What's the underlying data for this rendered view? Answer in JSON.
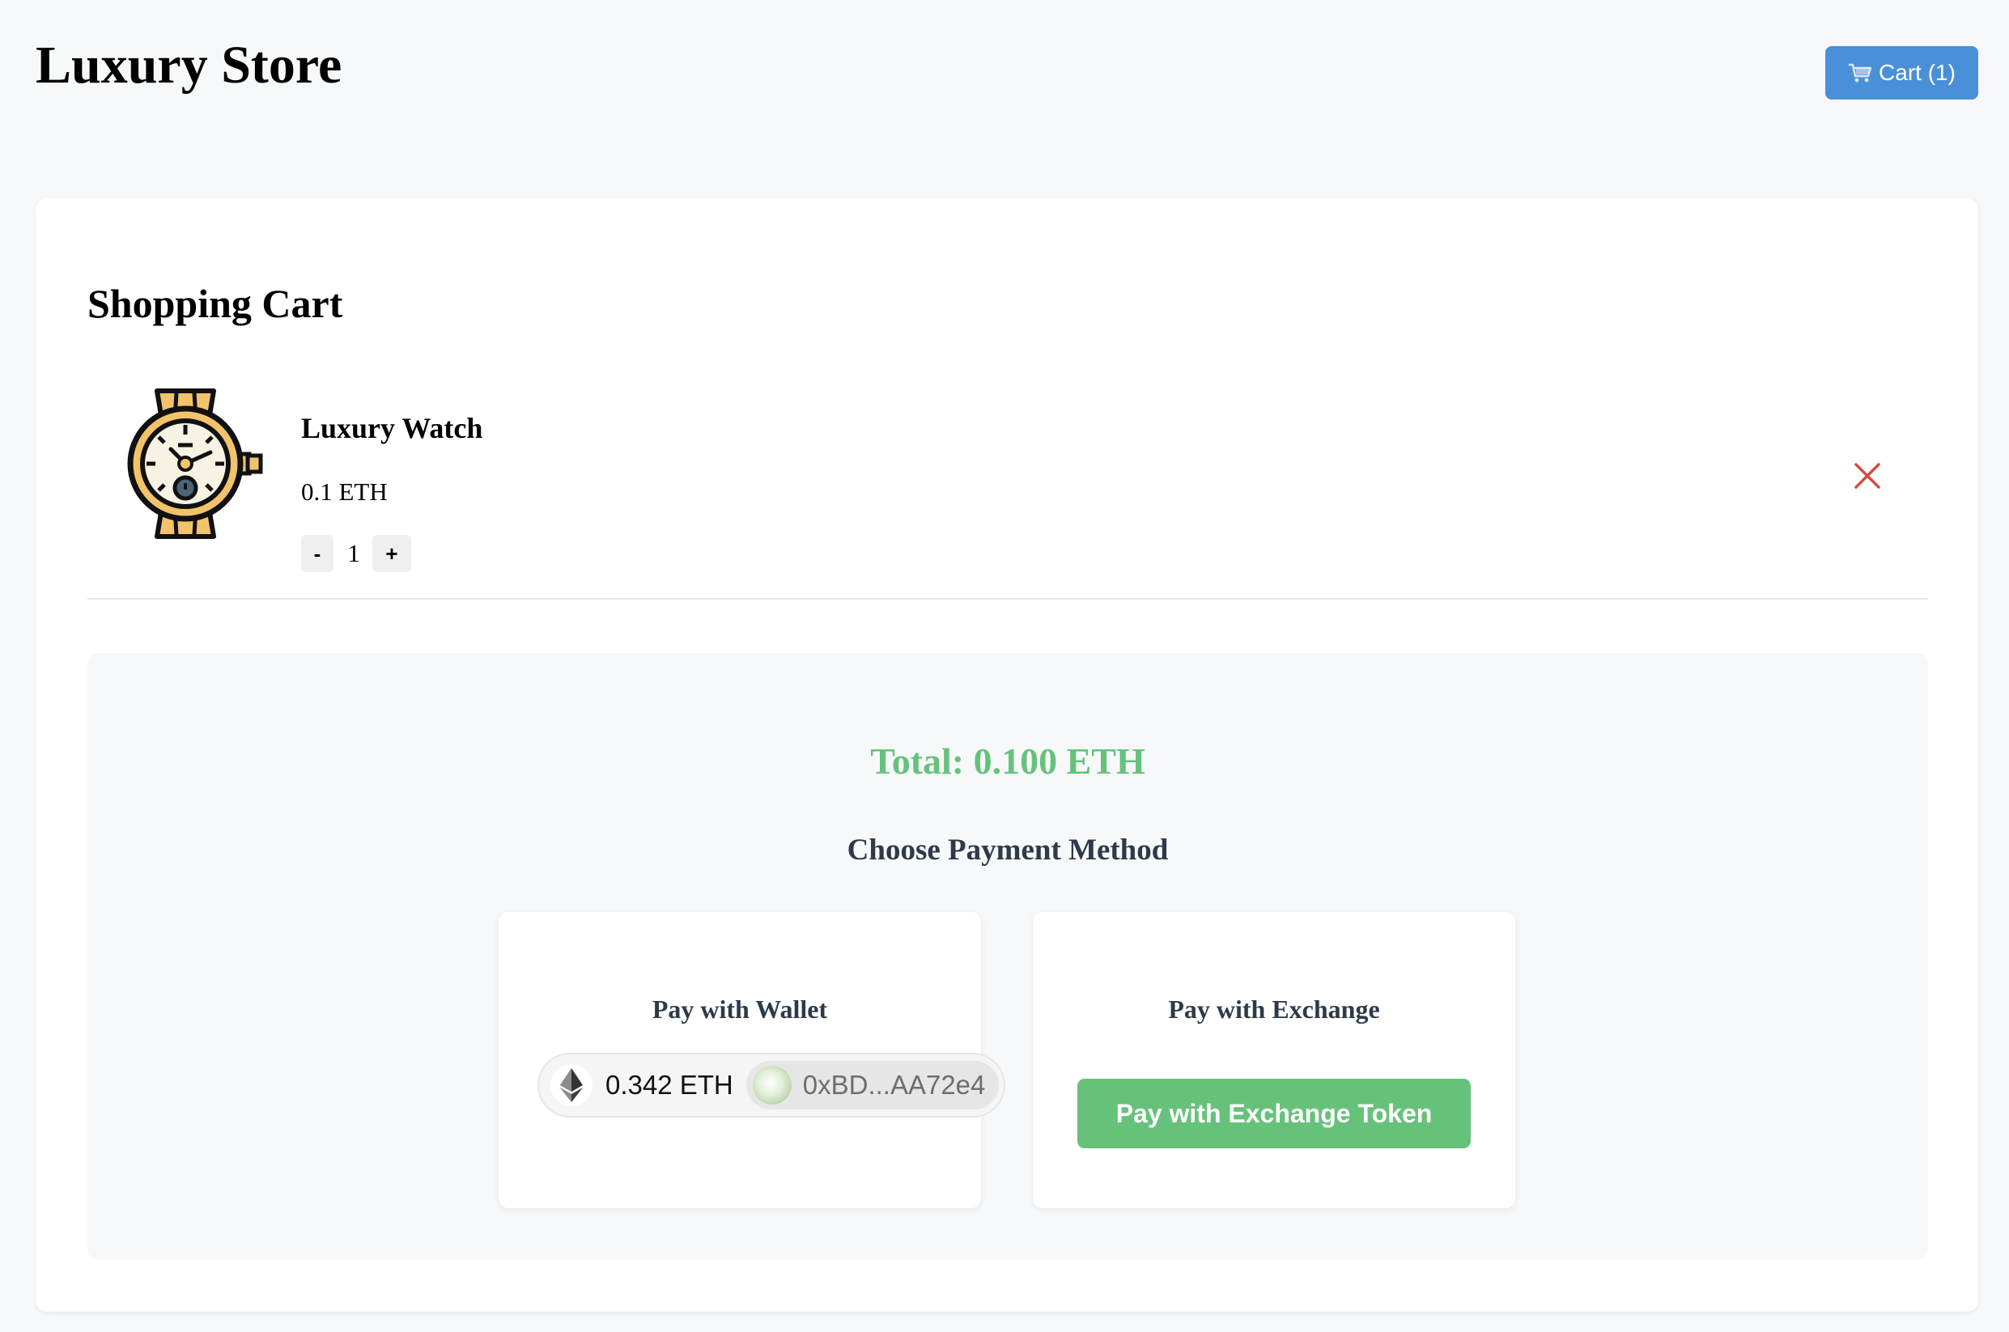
{
  "header": {
    "store_title": "Luxury Store",
    "cart_button_label": "Cart (1)",
    "cart_icon": "shopping-cart-icon"
  },
  "cart": {
    "heading": "Shopping Cart",
    "items": [
      {
        "name": "Luxury Watch",
        "price": "0.1 ETH",
        "quantity": "1",
        "image_icon": "wristwatch-icon",
        "decrement_label": "-",
        "increment_label": "+",
        "remove_icon": "close-icon"
      }
    ]
  },
  "checkout": {
    "total": "Total: 0.100 ETH",
    "payment_heading": "Choose Payment Method",
    "wallet": {
      "title": "Pay with Wallet",
      "balance": "0.342 ETH",
      "address": "0xBD...AA72e4",
      "network_icon": "ethereum-icon"
    },
    "exchange": {
      "title": "Pay with Exchange",
      "button_label": "Pay with Exchange Token"
    }
  },
  "colors": {
    "primary_blue": "#4a90d9",
    "success_green": "#66c27b",
    "remove_red": "#d0503d",
    "heading_dark": "#2d3a4a",
    "background": "#f7f8fa"
  }
}
